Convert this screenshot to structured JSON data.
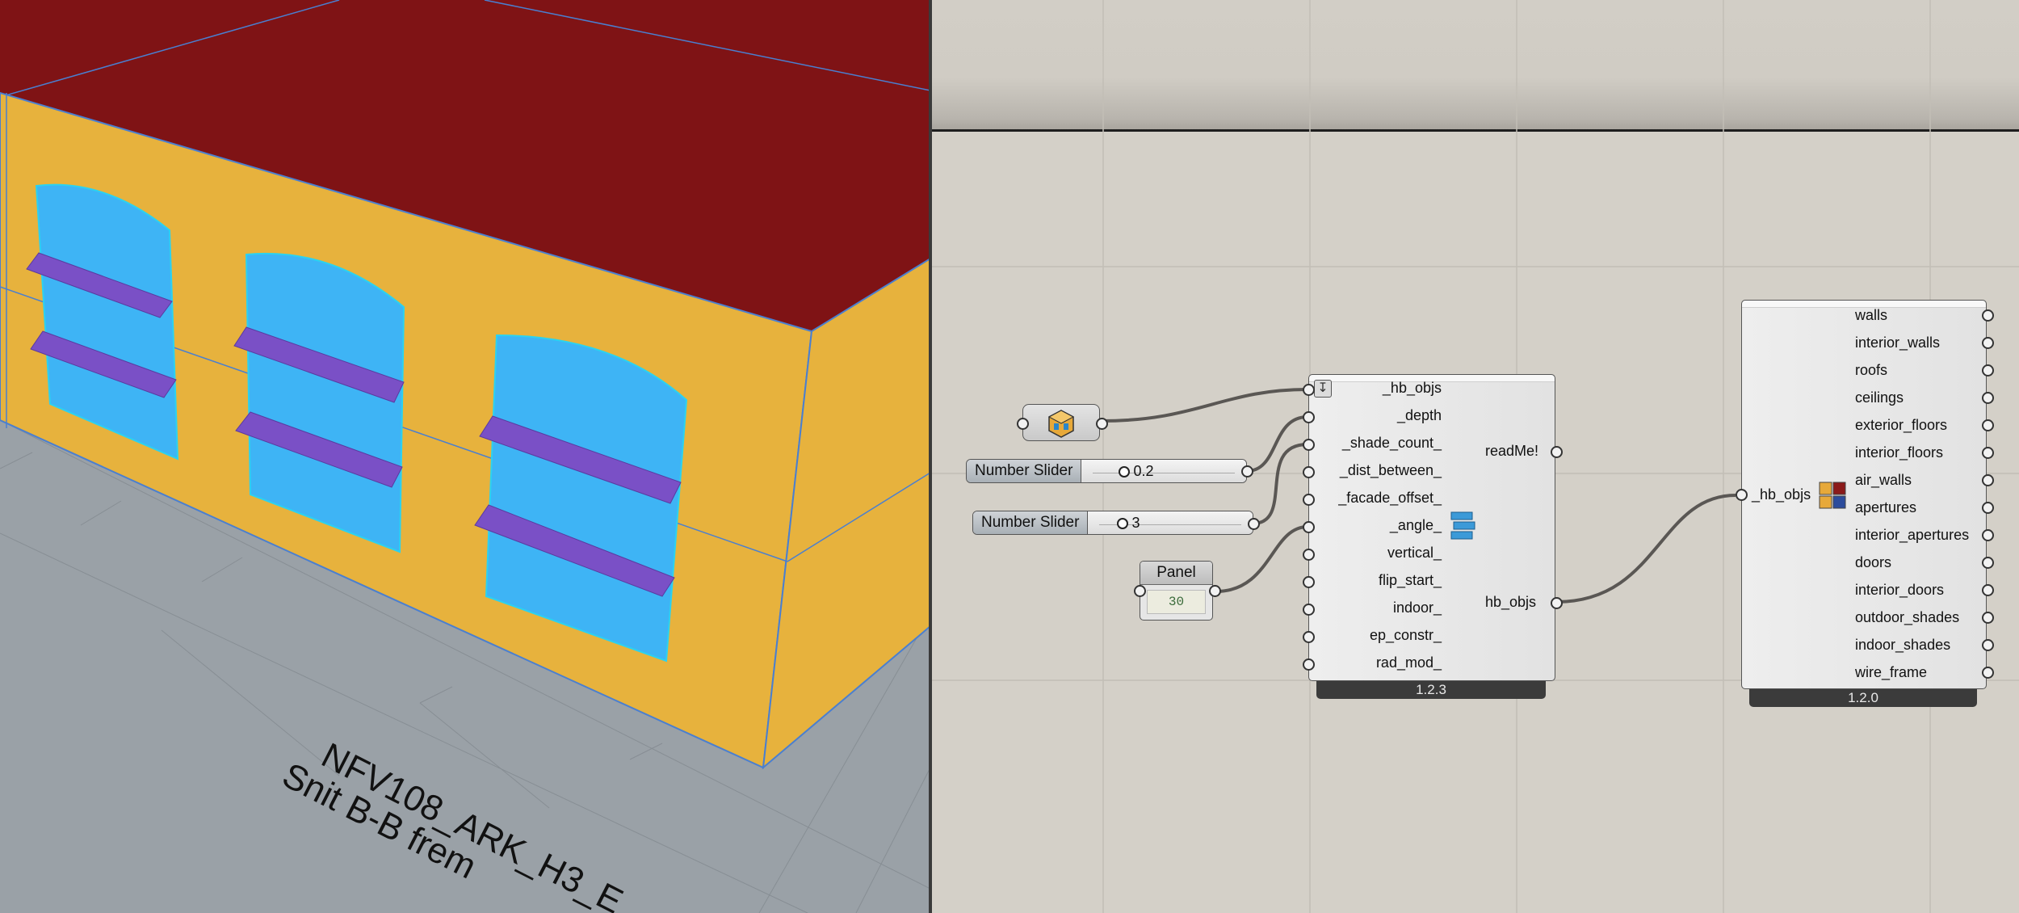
{
  "viewport": {
    "text_line1": "NFV108_ARK_H3_E",
    "text_line2": "Snit B-B frem"
  },
  "colors": {
    "roof": "#7f1315",
    "wall": "#e7b23d",
    "window": "#3eb4f5",
    "shade": "#7a50c6",
    "ground": "#9aa1a7",
    "canvas": "#d4d0c8"
  },
  "sliders": [
    {
      "label": "Number Slider",
      "value": "0.2"
    },
    {
      "label": "Number Slider",
      "value": "3"
    }
  ],
  "panel": {
    "title": "Panel",
    "value": "30"
  },
  "louvers_component": {
    "inputs": [
      "_hb_objs",
      "_depth",
      "_shade_count_",
      "_dist_between_",
      "_facade_offset_",
      "_angle_",
      "vertical_",
      "flip_start_",
      "indoor_",
      "ep_constr_",
      "rad_mod_"
    ],
    "outputs": [
      "readMe!",
      "hb_objs"
    ],
    "version": "1.2.3",
    "icon": "louvers-icon"
  },
  "deconstruct_component": {
    "input": "_hb_objs",
    "outputs": [
      "walls",
      "interior_walls",
      "roofs",
      "ceilings",
      "exterior_floors",
      "interior_floors",
      "air_walls",
      "apertures",
      "interior_apertures",
      "doors",
      "interior_doors",
      "outdoor_shades",
      "indoor_shades",
      "wire_frame"
    ],
    "version": "1.2.0",
    "icon": "deconstruct-model-icon"
  }
}
